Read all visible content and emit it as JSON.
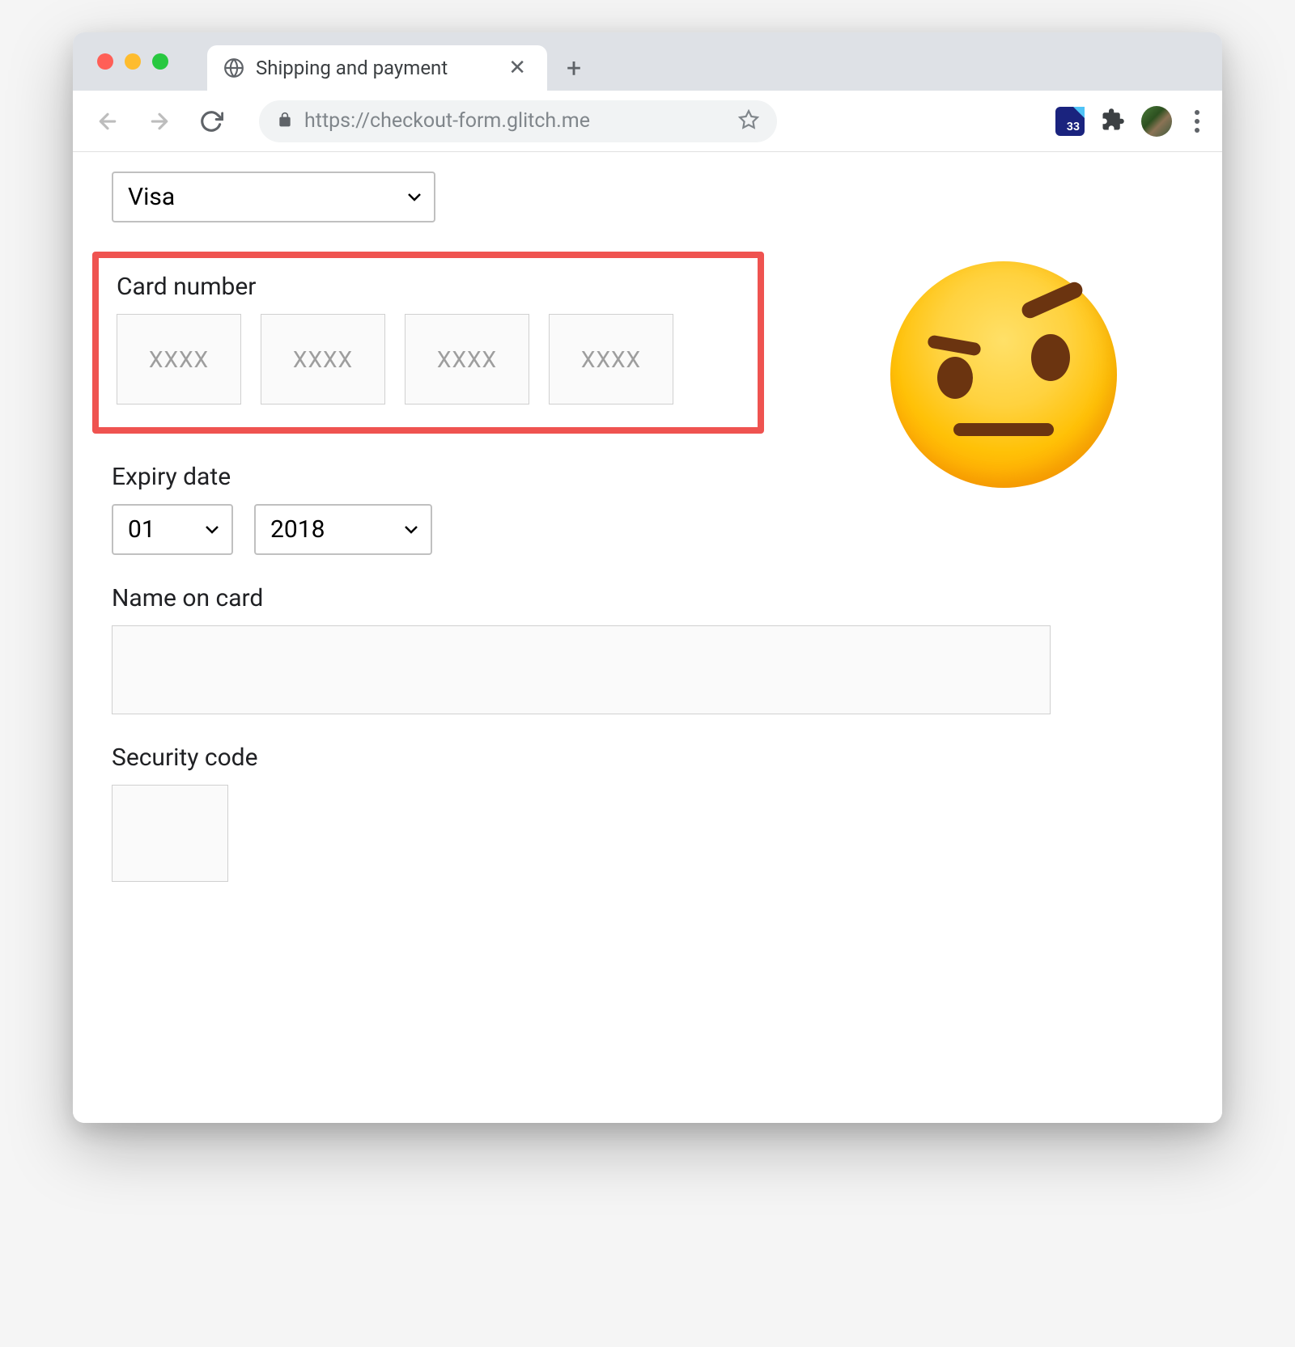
{
  "browser": {
    "tab_title": "Shipping and payment",
    "url": "https://checkout-form.glitch.me",
    "extension_badge": "33"
  },
  "form": {
    "card_type": {
      "selected": "Visa"
    },
    "card_number": {
      "label": "Card number",
      "placeholder": "XXXX"
    },
    "expiry": {
      "label": "Expiry date",
      "month": "01",
      "year": "2018"
    },
    "name_on_card": {
      "label": "Name on card",
      "value": ""
    },
    "security_code": {
      "label": "Security code",
      "value": ""
    }
  },
  "annotation": {
    "emoji": "raised-eyebrow-face",
    "highlight_color": "#ef5350"
  }
}
